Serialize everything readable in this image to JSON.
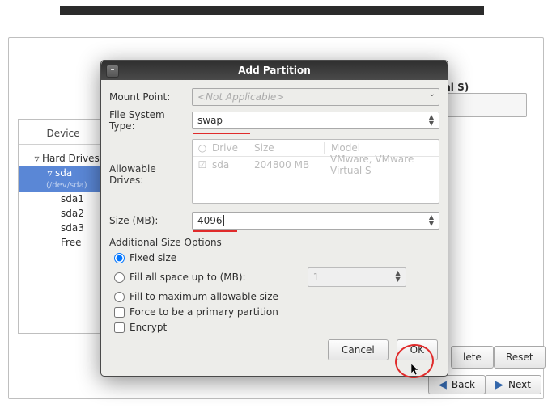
{
  "drive_label": "Drive /dev/sda (204800 MB) (Model: VMware, VMware Virtual S)",
  "tree": {
    "col": "Device",
    "root": "Hard Drives",
    "sda": "sda",
    "sda_hint": "(/dev/sda)",
    "sda1": "sda1",
    "sda2": "sda2",
    "sda3": "sda3",
    "free": "Free"
  },
  "nav": {
    "back": "Back",
    "next": "Next"
  },
  "side": {
    "delete": "lete",
    "reset": "Reset"
  },
  "dialog": {
    "title": "Add Partition",
    "mount_label": "Mount Point:",
    "mount_value": "<Not Applicable>",
    "fstype_label": "File System Type:",
    "fstype_value": "swap",
    "allow_label": "Allowable Drives:",
    "drives": {
      "cols": {
        "drive": "Drive",
        "size": "Size",
        "model": "Model"
      },
      "row": {
        "name": "sda",
        "size": "204800 MB",
        "model": "VMware, VMware Virtual S"
      }
    },
    "size_label": "Size (MB):",
    "size_value": "4096",
    "addl_label": "Additional Size Options",
    "opt_fixed": "Fixed size",
    "opt_fill_up": "Fill all space up to (MB):",
    "opt_fill_up_val": "1",
    "opt_fill_max": "Fill to maximum allowable size",
    "chk_primary": "Force to be a primary partition",
    "chk_encrypt": "Encrypt",
    "cancel": "Cancel",
    "ok": "OK"
  }
}
